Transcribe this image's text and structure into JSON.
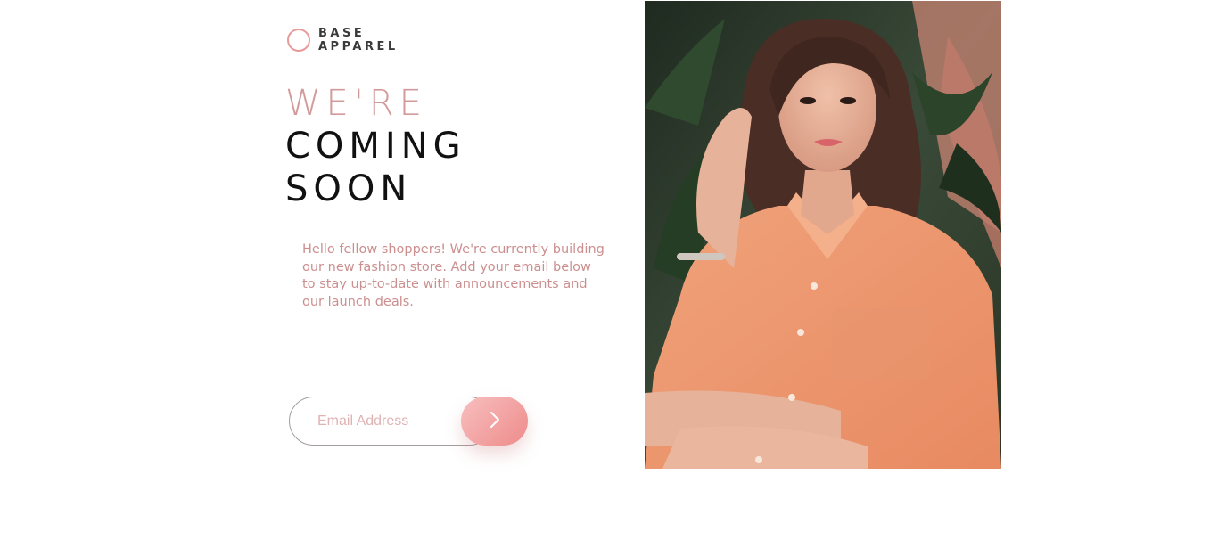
{
  "brand": {
    "line1": "BASE",
    "line2": "APPAREL",
    "accent_color": "#e89b9b"
  },
  "headline": {
    "accent": "WE'RE",
    "line2": "COMING",
    "line3": "SOON"
  },
  "description": "Hello fellow shoppers! We're currently building our new fashion store. Add your email below to stay up-to-date with announcements and our launch deals.",
  "form": {
    "email_placeholder": "Email Address",
    "submit_icon": "chevron-right-icon",
    "button_gradient": [
      "#f8bfbf",
      "#ee8b8b"
    ]
  },
  "hero": {
    "image_subject": "woman-in-peach-shirt-photo"
  },
  "colors": {
    "text_accent": "#d29a9a",
    "text_dark": "#111111",
    "body_text": "#cc8f8f"
  }
}
